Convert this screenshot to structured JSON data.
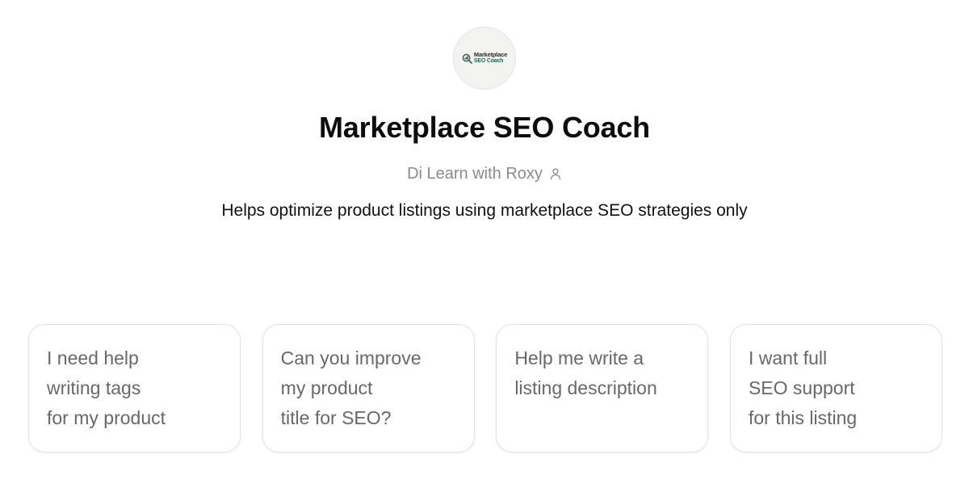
{
  "gpt": {
    "logo_line1": "Marketplace",
    "logo_line2": "SEO Coach",
    "title": "Marketplace SEO Coach",
    "author": "Di Learn with Roxy",
    "author_icon": "person-icon",
    "description": "Helps optimize product listings using marketplace SEO strategies only"
  },
  "conversation_starters": [
    {
      "text": "I need help\nwriting tags\nfor my product"
    },
    {
      "text": "Can you improve\nmy product\ntitle for SEO?"
    },
    {
      "text": "Help me write a\nlisting description"
    },
    {
      "text": "I want full\nSEO support\nfor this listing"
    }
  ],
  "colors": {
    "title": "#0d0d0d",
    "muted": "#8a8a8a",
    "starter_text": "#686868",
    "border": "#e2e2e2",
    "logo_accent": "#1f6b55"
  }
}
